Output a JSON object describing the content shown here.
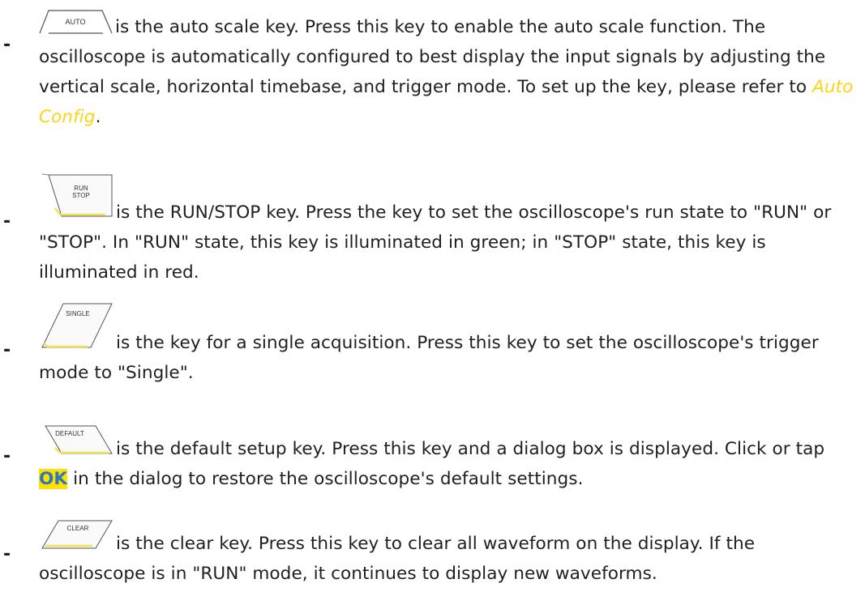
{
  "items": [
    {
      "key_label": "AUTO",
      "key_icon": "auto-key-icon",
      "text_first": "is the auto scale key. Press this key to enable the auto scale function. The oscilloscope is automatically configured to best display the input signals by adjusting the vertical scale, horizontal timebase, and trigger mode. To set up the key, please refer to ",
      "link_text": "Auto Config",
      "text_after_link": "."
    },
    {
      "key_label_top": "RUN",
      "key_label_bottom": "STOP",
      "key_icon": "run-stop-key-icon",
      "text": "is the RUN/STOP key. Press the key to set the oscilloscope's run state to \"RUN\" or \"STOP\". In \"RUN\" state, this key is illuminated in green; in \"STOP\" state, this key is illuminated in red."
    },
    {
      "key_label": "SINGLE",
      "key_icon": "single-key-icon",
      "text": "is the key for a single acquisition. Press this key to set the oscilloscope's trigger mode to \"Single\"."
    },
    {
      "key_label": "DEFAULT",
      "key_icon": "default-key-icon",
      "text_first": "is the default setup key. Press this key and a dialog box is displayed. Click or tap ",
      "highlight": "OK",
      "text_after": " in the dialog to restore the oscilloscope's default settings."
    },
    {
      "key_label": "CLEAR",
      "key_icon": "clear-key-icon",
      "text": "is the clear key. Press this key to clear all waveform on the display. If the oscilloscope is in \"RUN\" mode, it continues to display new waveforms."
    }
  ],
  "bullet": "-",
  "colors": {
    "link": "#ffd21a",
    "highlight_bg": "#ffe100",
    "highlight_text": "#2f76ba",
    "key_accent": "#f2e25a"
  }
}
